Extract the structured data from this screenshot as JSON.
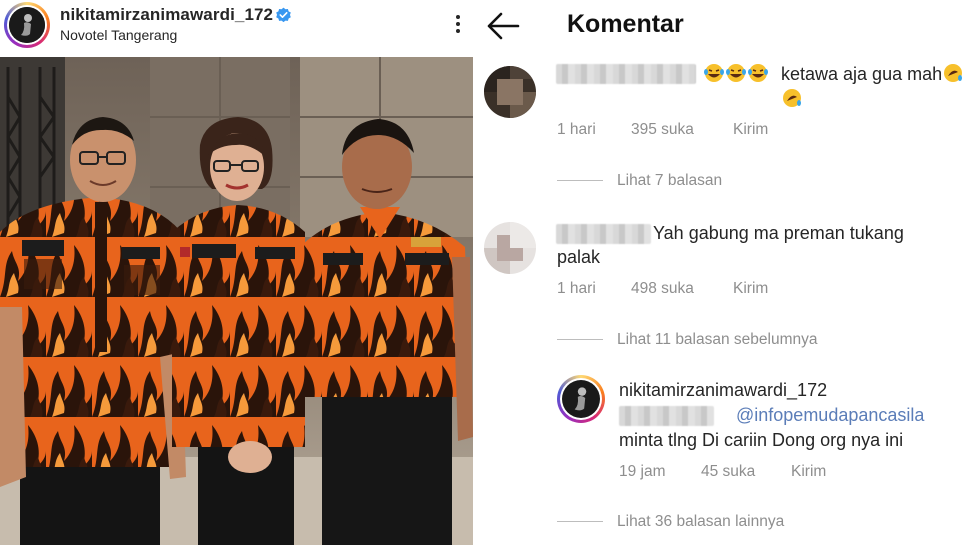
{
  "post": {
    "username": "nikitamirzanimawardi_172",
    "location": "Novotel Tangerang"
  },
  "comments_panel": {
    "title": "Komentar",
    "comments": [
      {
        "text": "ketawa aja gua mah",
        "time": "1 hari",
        "likes": "395 suka",
        "reply_label": "Kirim",
        "view_replies": "Lihat 7 balasan"
      },
      {
        "text_line1": "Yah gabung ma preman tukang",
        "text_line2": "palak",
        "time": "1 hari",
        "likes": "498 suka",
        "reply_label": "Kirim",
        "view_replies": "Lihat 11 balasan sebelumnya"
      }
    ],
    "reply": {
      "username": "nikitamirzanimawardi_172",
      "mention": "@infopemudapancasila",
      "text": "minta tlng Di cariin Dong org nya ini",
      "time": "19 jam",
      "likes": "45 suka",
      "reply_label": "Kirim",
      "view_more": "Lihat 36 balasan lainnya"
    }
  },
  "colors": {
    "muted": "#8e8e8e",
    "mention": "#5b7db8",
    "verified": "#3897f0",
    "uniform_orange": "#e8641c"
  }
}
